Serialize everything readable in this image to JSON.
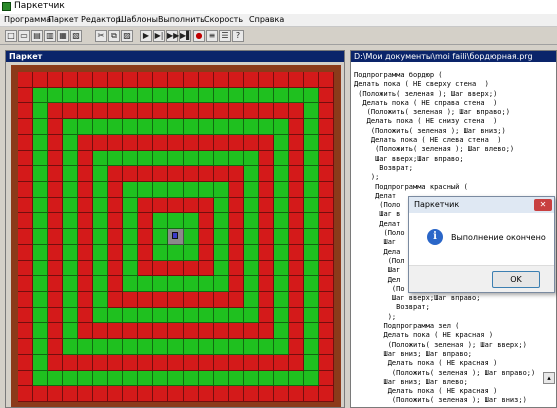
{
  "window": {
    "title": "Паркетчик"
  },
  "menu": [
    "Программа",
    "Паркет",
    "Редактор",
    "Шаблоны",
    "Выполнить",
    "Скорость",
    "Справка"
  ],
  "toolbar": {
    "buttons": [
      {
        "name": "new-icon",
        "glyph": "□"
      },
      {
        "name": "open-icon",
        "glyph": "▭"
      },
      {
        "name": "open-file-icon",
        "glyph": "▤"
      },
      {
        "name": "save-icon",
        "glyph": "▥"
      },
      {
        "name": "save-as-icon",
        "glyph": "▦"
      },
      {
        "name": "print-icon",
        "glyph": "▧"
      },
      {
        "name": "cut-icon",
        "glyph": "✂"
      },
      {
        "name": "copy-icon",
        "glyph": "⧉"
      },
      {
        "name": "paste-icon",
        "glyph": "▨"
      },
      {
        "name": "run-icon",
        "glyph": "▶"
      },
      {
        "name": "step-icon",
        "glyph": "▶|"
      },
      {
        "name": "fast-forward-icon",
        "glyph": "▶▶"
      },
      {
        "name": "end-icon",
        "glyph": "▶▌"
      },
      {
        "name": "stop-icon",
        "glyph": "●"
      },
      {
        "name": "template-icon",
        "glyph": "≡"
      },
      {
        "name": "template-list-icon",
        "glyph": "☰"
      },
      {
        "name": "help-icon",
        "glyph": "?"
      }
    ]
  },
  "left_panel": {
    "title": "Паркет"
  },
  "board": {
    "grid_size": 21,
    "pattern": "concentric rings alternating red and green, brick border",
    "colors": {
      "border": "#8b3a1a",
      "red": "#d41a1a",
      "green": "#1fc01f",
      "center": "#3a3ac8"
    }
  },
  "right_panel": {
    "title": "D:\\Мои документы\\moi faili\\бордюрная.prg",
    "code_lines": [
      "Подпрограмма бордюр (",
      "Делать пока ( НЕ сверху стена  )",
      " (Положить( зеленая ); Шаг вверх;)",
      "  Делать пока ( НЕ справа стена  )",
      "   (Положить( зеленая ); Шаг вправо;)",
      "   Делать пока ( НЕ снизу стена  )",
      "    (Положить( зеленая ); Шаг вниз;)",
      "    Делать пока ( НЕ слева стена  )",
      "     (Положить( зеленая ); Шаг влево;)",
      "     Шаг вверх;Шаг вправо;",
      "      Возврат;",
      "    );",
      "     Подпрограмма красный (",
      "     Делат",
      "      (Поло",
      "      Шаг в",
      "      Делат",
      "       (Поло",
      "       Шаг",
      "       Дела",
      "        (Пол",
      "        Шаг",
      "        Дел",
      "         (По",
      "         Шаг вверх;Шаг вправо;",
      "          Возврат;",
      "        );",
      "       Подпрограмма зел (",
      "       Делать пока ( НЕ красная )",
      "        (Положить( зеленая ); Шаг вверх;)",
      "       Шаг вниз; Шаг вправо;",
      "        Делать пока ( НЕ красная )",
      "         (Положить( зеленая ); Шаг вправо;)",
      "       Шаг вниз; Шаг влево;",
      "        Делать пока ( НЕ красная )",
      "         (Положить( зеленая ); Шаг вниз;)"
    ]
  },
  "dialog": {
    "title": "Паркетчик",
    "close_glyph": "✕",
    "info_glyph": "i",
    "message": "Выполнение окончено",
    "ok_label": "OK"
  },
  "scroll_glyph": "▴"
}
